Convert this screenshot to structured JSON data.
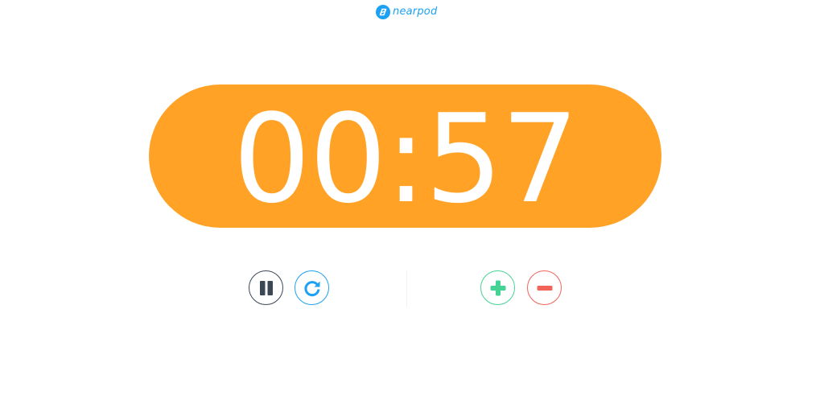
{
  "brand": {
    "logo_text": "nearpod",
    "logo_icon": "nearpod-logo-icon",
    "color": "#1da1f2"
  },
  "timer": {
    "display": "00:57",
    "pill_color": "#ffa226",
    "text_color": "#ffffff"
  },
  "controls": {
    "pause": {
      "icon": "pause-icon",
      "color": "#3b4754"
    },
    "restart": {
      "icon": "restart-icon",
      "color": "#1da1f2"
    },
    "add_time": {
      "icon": "plus-icon",
      "color": "#44d394"
    },
    "subtract_time": {
      "icon": "minus-icon",
      "color": "#f0645a"
    }
  }
}
